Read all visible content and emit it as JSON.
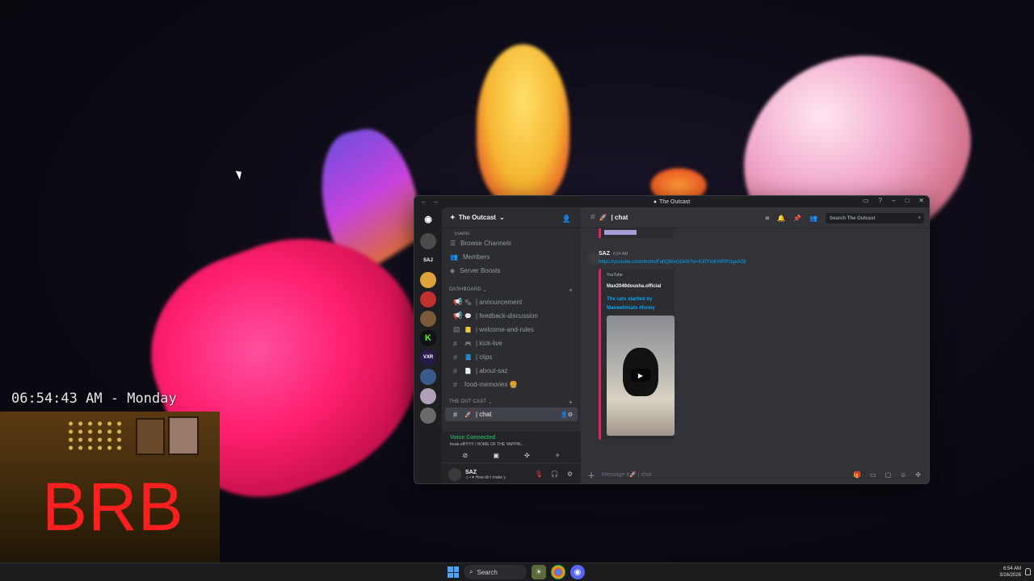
{
  "overlay": {
    "clock": "06:54:43 AM - Monday",
    "brb": "BRB"
  },
  "taskbar": {
    "search_label": "Search",
    "time": "6:54 AM",
    "date": "3/16/2026"
  },
  "window": {
    "title": "The Outcast",
    "controls": [
      "inbox-icon",
      "help-icon",
      "minimize",
      "maximize",
      "close"
    ]
  },
  "server": {
    "name": "The Outcast",
    "nav": [
      {
        "label": "Events",
        "icon": "calendar-icon"
      },
      {
        "label": "Browse Channels",
        "icon": "browse-icon"
      },
      {
        "label": "Members",
        "icon": "members-icon"
      },
      {
        "label": "Server Boosts",
        "icon": "boost-icon"
      }
    ],
    "categories": [
      {
        "name": "DASHBOARD",
        "channels": [
          {
            "label": "| announcement",
            "icon": "megaphone-icon",
            "emoji": "🗞"
          },
          {
            "label": "| feedback-discussion",
            "icon": "megaphone-icon",
            "emoji": "💬"
          },
          {
            "label": "| welcome-and-rules",
            "icon": "rules-icon",
            "emoji": "📒"
          },
          {
            "label": "| kick-live",
            "icon": "hash-icon",
            "emoji": "🎮"
          },
          {
            "label": "| clips",
            "icon": "hash-icon",
            "emoji": "📘"
          },
          {
            "label": "| about-saz",
            "icon": "hash-icon",
            "emoji": "📄"
          },
          {
            "label": "food-memories 🍔",
            "icon": "hash-icon",
            "emoji": ""
          }
        ]
      },
      {
        "name": "THE OUT CAST",
        "channels": [
          {
            "label": "| chat",
            "icon": "hash-icon",
            "emoji": "🚀",
            "active": true
          }
        ]
      }
    ]
  },
  "voice": {
    "status": "Voice Connected",
    "sub": "freak-off!!!!!!!! / HOME OF THE YAPPIN..."
  },
  "user": {
    "name": "SAZ",
    "status": "♫ • ♥ How do I make y"
  },
  "channel": {
    "name": "| chat",
    "search_placeholder": "Search The Outcast",
    "composer_placeholder": "Message #🚀 | chat"
  },
  "message": {
    "author": "SAZ",
    "time": "6:24 AM",
    "link": "https://youtube.com/shorts/FahQWvGDk5I?si=0J0YIoKWRPOgxAZ6",
    "embed": {
      "provider": "YouTube",
      "author": "Max2049dousha.official",
      "title": "The cats startled by Maxwell#cats #funny"
    }
  },
  "colors": {
    "accent_red": "#e0245e",
    "link_blue": "#00a8fc",
    "voice_green": "#23a55a",
    "brb_red": "#ff1f1f"
  }
}
